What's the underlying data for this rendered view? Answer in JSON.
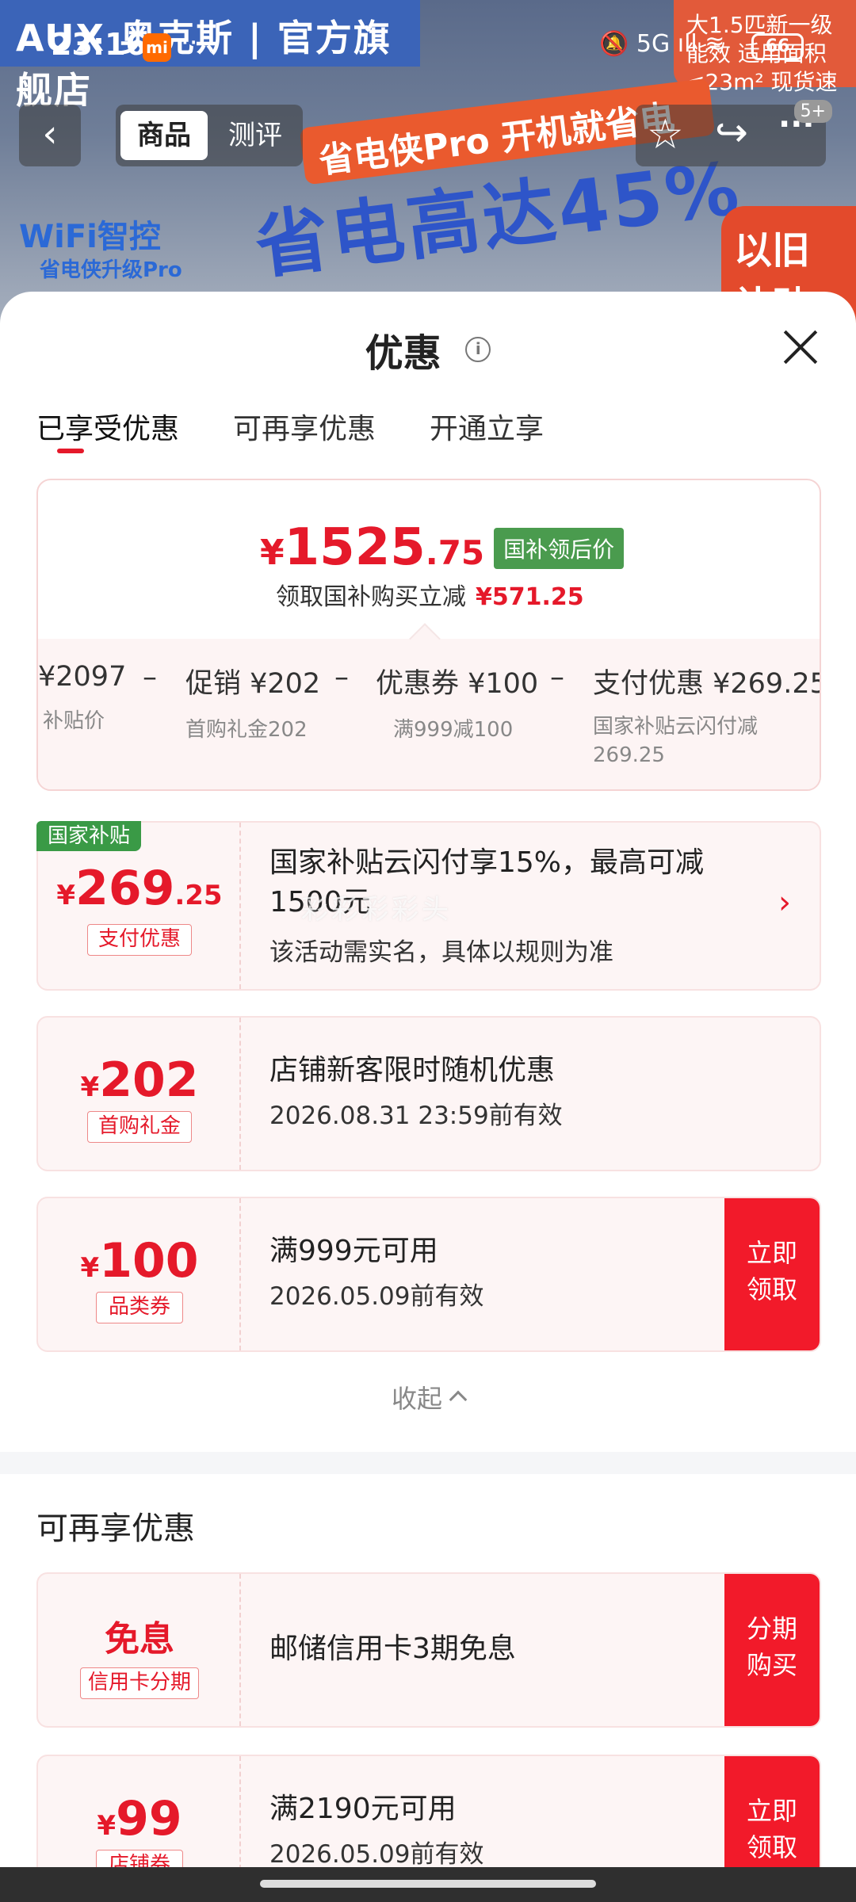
{
  "background": {
    "banner": "AUX 奥克斯 | 官方旗舰店",
    "top_right": "大1.5匹新一级能效 适用面积≤23m² 现货速发",
    "slogan1": "省电侠Pro 开机就省电",
    "slogan2": "省电高达45%",
    "wifi": "WiFi智控",
    "wifi_sub": "省电侠升级Pro",
    "subsidy": "以旧 补贴"
  },
  "status_bar": {
    "time": "23:16",
    "mi": "mi",
    "dots": "···",
    "icons": "🔕 5G ıll ≋",
    "battery": "66"
  },
  "nav": {
    "back": "‹",
    "tab_product": "商品",
    "tab_review": "测评",
    "star": "☆",
    "share": "↪",
    "more": "···",
    "badge": "5+"
  },
  "sheet": {
    "title": "优惠",
    "info": "i",
    "tabs": [
      "已享受优惠",
      "可再享优惠",
      "开通立享"
    ]
  },
  "summary": {
    "price_symbol": "¥",
    "price_int": "1525",
    "price_dec": ".75",
    "price_tag": "国补领后价",
    "reduce_label": "领取国补购买立减",
    "reduce_amount": "¥571.25",
    "breakdown": [
      {
        "value": "¥2097",
        "label": "补贴价"
      },
      {
        "value": "促销 ¥202",
        "label": "首购礼金202"
      },
      {
        "value": "优惠券 ¥100",
        "label": "满999减100"
      },
      {
        "value": "支付优惠 ¥269.25",
        "label": "国家补贴云闪付减",
        "label2": "269.25"
      }
    ],
    "minus": "–"
  },
  "coupons": [
    {
      "badge": "国家补贴",
      "symbol": "¥",
      "int": "269",
      "dec": ".25",
      "tag": "支付优惠",
      "main": "国家补贴云闪付享15%，最高可减",
      "main2": "1500元",
      "sub": "该活动需实名，具体以规则为准",
      "chev": "›"
    },
    {
      "symbol": "¥",
      "int": "202",
      "dec": "",
      "tag": "首购礼金",
      "main": "店铺新客限时随机优惠",
      "sub": "2026.08.31 23:59前有效"
    },
    {
      "symbol": "¥",
      "int": "100",
      "dec": "",
      "tag": "品类券",
      "main": "满999元可用",
      "sub": "2026.05.09前有效",
      "action1": "立即",
      "action2": "领取"
    }
  ],
  "collapse_label": "收起",
  "watermark": "彩彩彩彩头",
  "more_section": {
    "title": "可再享优惠",
    "items": [
      {
        "amount_text": "免息",
        "tag": "信用卡分期",
        "main": "邮储信用卡3期免息",
        "action1": "分期",
        "action2": "购买"
      },
      {
        "symbol": "¥",
        "int": "99",
        "tag": "店铺券",
        "main": "满2190元可用",
        "sub": "2026.05.09前有效",
        "action1": "立即",
        "action2": "领取"
      }
    ]
  }
}
